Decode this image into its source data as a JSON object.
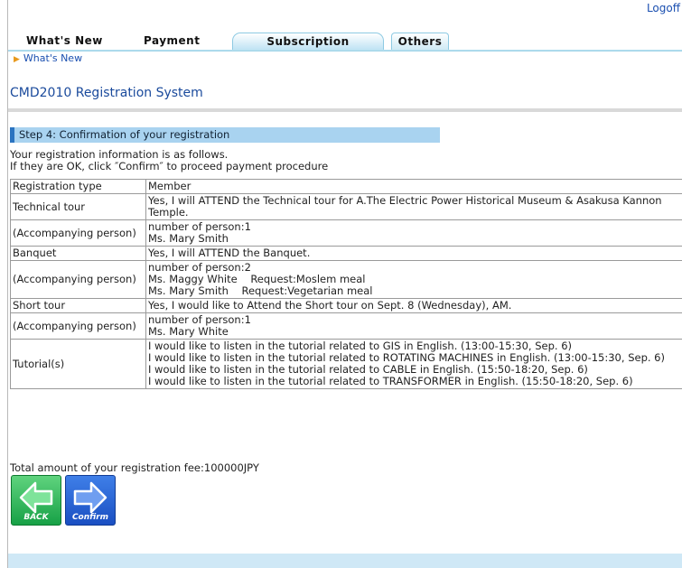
{
  "header": {
    "logoff": "Logoff"
  },
  "tabs": [
    {
      "label": "What's New"
    },
    {
      "label": "Payment"
    },
    {
      "label": "Subscription"
    },
    {
      "label": "Others"
    }
  ],
  "breadcrumb": {
    "label": "What's New"
  },
  "system_title": "CMD2010 Registration System",
  "step_title": "Step 4: Confirmation of your registration",
  "intro": {
    "line1": "Your registration information is as follows.",
    "line2": "If they are OK, click ″Confirm″ to proceed payment procedure"
  },
  "rows": [
    {
      "label": "Registration type",
      "lines": [
        "Member"
      ]
    },
    {
      "label": "Technical tour",
      "lines": [
        "Yes, I will ATTEND the Technical tour for A.The Electric Power Historical Museum & Asakusa Kannon Temple."
      ]
    },
    {
      "label": "(Accompanying person)",
      "lines": [
        "number of person:1",
        "Ms. Mary Smith"
      ]
    },
    {
      "label": "Banquet",
      "lines": [
        "Yes, I will ATTEND the Banquet."
      ]
    },
    {
      "label": "(Accompanying person)",
      "lines": [
        "number of person:2",
        "Ms. Maggy White    Request:Moslem meal",
        "Ms. Mary Smith    Request:Vegetarian meal"
      ]
    },
    {
      "label": "Short tour",
      "lines": [
        "Yes, I would like to Attend the Short tour on Sept. 8 (Wednesday), AM."
      ]
    },
    {
      "label": "(Accompanying person)",
      "lines": [
        "number of person:1",
        "Ms. Mary White"
      ]
    },
    {
      "label": "Tutorial(s)",
      "lines": [
        "I would like to listen in the tutorial related to GIS in English. (13:00-15:30, Sep. 6)",
        "I would like to listen in the tutorial related to ROTATING MACHINES in English. (13:00-15:30, Sep. 6)",
        "I would like to listen in the tutorial related to CABLE in English. (15:50-18:20, Sep. 6)",
        "I would like to listen in the tutorial related to TRANSFORMER in English. (15:50-18:20, Sep. 6)"
      ]
    }
  ],
  "total": "Total amount of your registration fee:100000JPY",
  "buttons": {
    "back": "BACK",
    "confirm": "Confirm"
  },
  "icons": {
    "back": "left-arrow-icon",
    "confirm": "right-arrow-icon",
    "breadcrumb": "triangle-right-icon"
  },
  "colors": {
    "back_button": "#17a146",
    "confirm_button": "#1a4fc2",
    "step_bar": "#a9d3f0",
    "link": "#1a4fb0"
  }
}
